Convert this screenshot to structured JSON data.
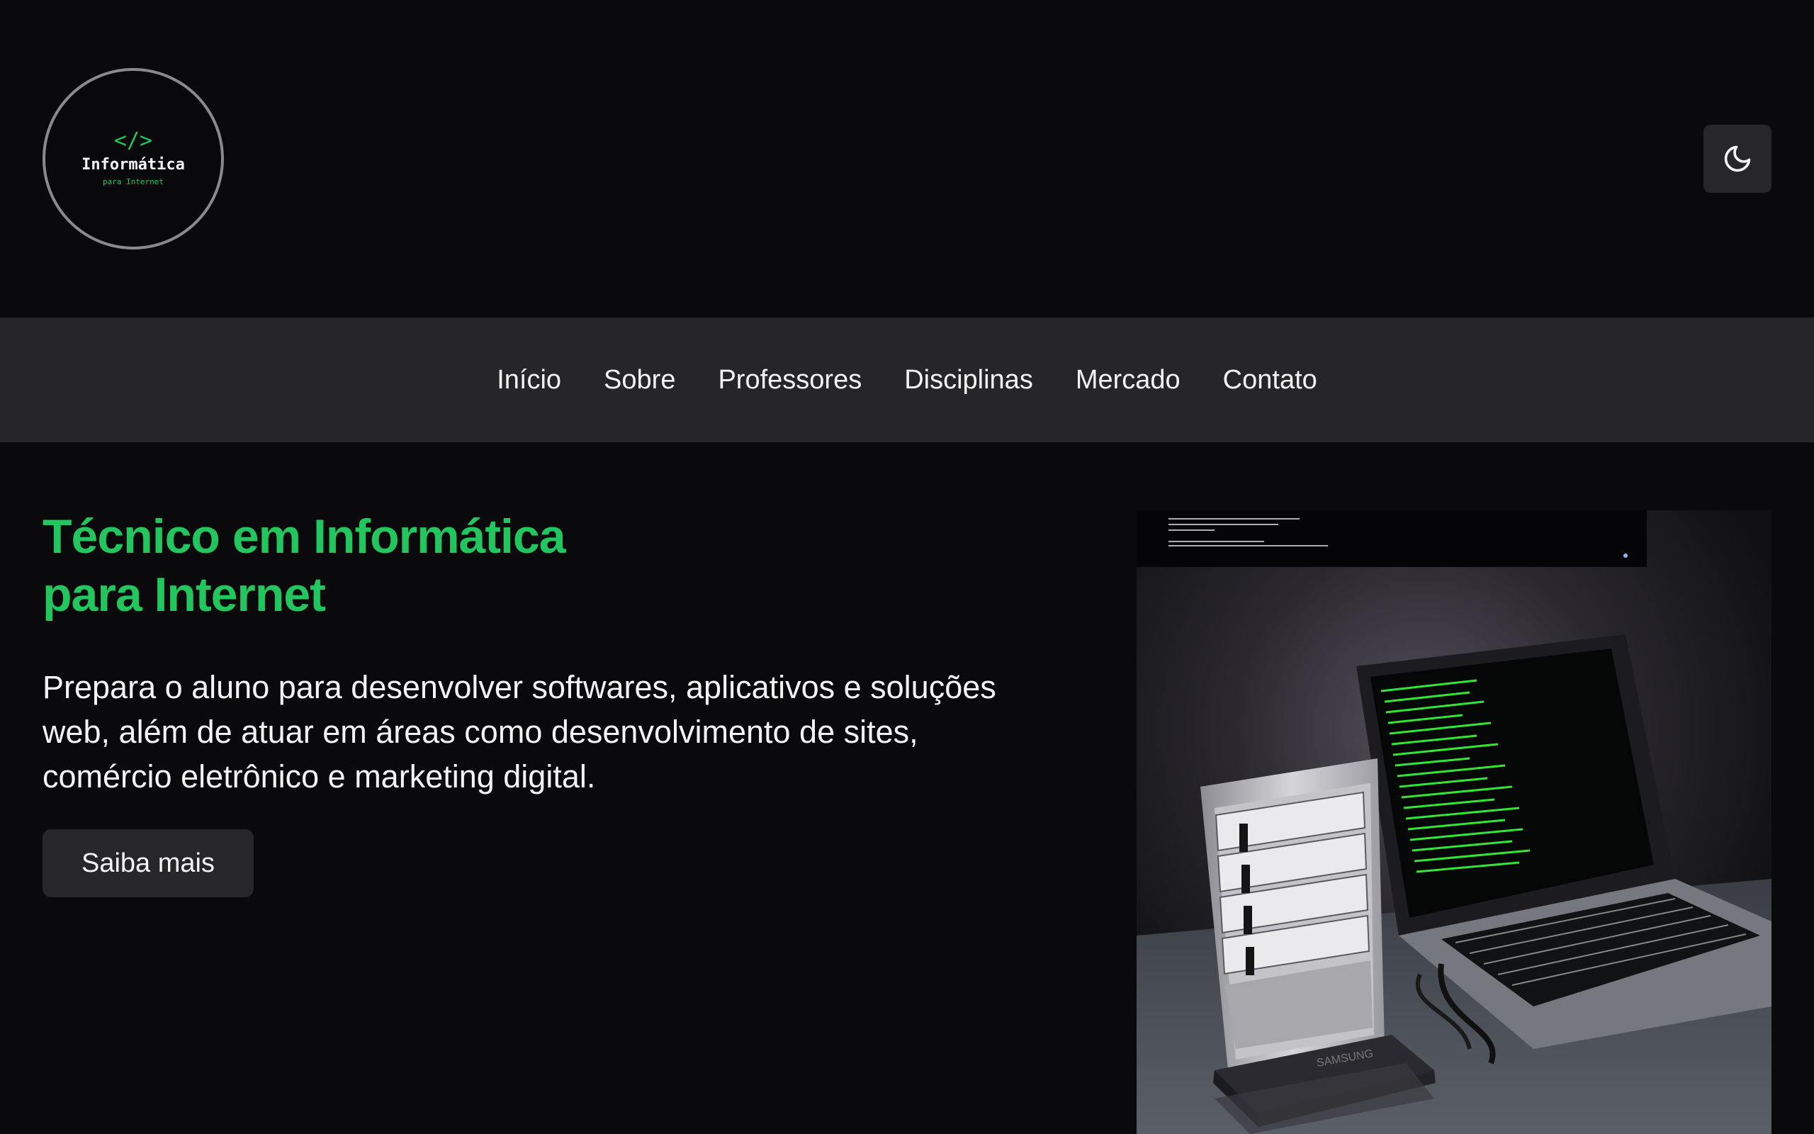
{
  "logo": {
    "code_symbol": "</>",
    "title": "Informática",
    "subtitle": "para Internet"
  },
  "header": {
    "theme_toggle_icon": "moon-icon"
  },
  "nav": {
    "items": [
      {
        "label": "Início"
      },
      {
        "label": "Sobre"
      },
      {
        "label": "Professores"
      },
      {
        "label": "Disciplinas"
      },
      {
        "label": "Mercado"
      },
      {
        "label": "Contato"
      }
    ]
  },
  "hero": {
    "title_line1": "Técnico em Informática",
    "title_line2": "para Internet",
    "description": "Prepara o aluno para desenvolver softwares, aplicativos e soluções web, além de atuar em áreas como desenvolvimento de sites, comércio eletrônico e marketing digital.",
    "button_label": "Saiba mais"
  },
  "colors": {
    "background": "#0a0a0c",
    "accent": "#22c55e",
    "nav_background": "#262628",
    "button_background": "#27272a",
    "text": "#f4f4f5"
  }
}
